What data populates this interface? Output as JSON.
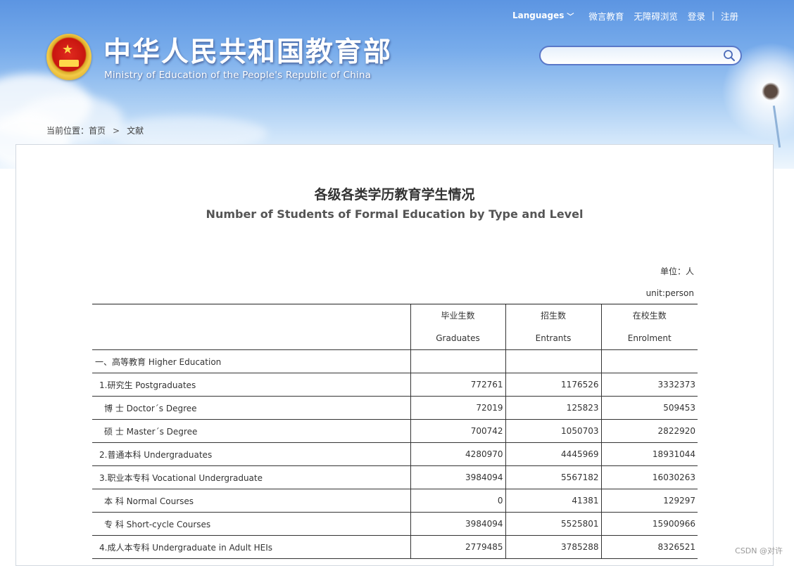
{
  "header": {
    "title": "中华人民共和国教育部",
    "subtitle": "Ministry of Education of the People's Republic of China",
    "emblem_icon": "national-emblem-icon"
  },
  "topnav": {
    "languages": "Languages",
    "wechat": "微言教育",
    "accessibility": "无障碍浏览",
    "login": "登录",
    "separator": "|",
    "register": "注册"
  },
  "search": {
    "placeholder": "",
    "value": ""
  },
  "breadcrumb": {
    "prefix": "当前位置：",
    "home": "首页",
    "separator": ">",
    "current": "文献"
  },
  "page": {
    "title_cn": "各级各类学历教育学生情况",
    "title_en": "Number of Students of Formal Education by Type and Level",
    "unit_cn": "单位：人",
    "unit_en": "unit:person"
  },
  "table": {
    "headers": [
      {
        "cn": "",
        "en": ""
      },
      {
        "cn": "毕业生数",
        "en": "Graduates"
      },
      {
        "cn": "招生数",
        "en": "Entrants"
      },
      {
        "cn": "在校生数",
        "en": "Enrolment"
      }
    ],
    "rows": [
      {
        "label": "一、高等教育 Higher Education",
        "graduates": "",
        "entrants": "",
        "enrolment": ""
      },
      {
        "label": "1.研究生 Postgraduates",
        "graduates": "772761",
        "entrants": "1176526",
        "enrolment": "3332373"
      },
      {
        "label": "博 士 Doctor´s Degree",
        "graduates": "72019",
        "entrants": "125823",
        "enrolment": "509453"
      },
      {
        "label": "硕 士 Master´s Degree",
        "graduates": "700742",
        "entrants": "1050703",
        "enrolment": "2822920"
      },
      {
        "label": "2.普通本科 Undergraduates",
        "graduates": "4280970",
        "entrants": "4445969",
        "enrolment": "18931044"
      },
      {
        "label": "3.职业本专科 Vocational Undergraduate",
        "graduates": "3984094",
        "entrants": "5567182",
        "enrolment": "16030263"
      },
      {
        "label": "本 科 Normal Courses",
        "graduates": "0",
        "entrants": "41381",
        "enrolment": "129297"
      },
      {
        "label": "专 科 Short-cycle Courses",
        "graduates": "3984094",
        "entrants": "5525801",
        "enrolment": "15900966"
      },
      {
        "label": "4.成人本专科 Undergraduate in Adult HEIs",
        "graduates": "2779485",
        "entrants": "3785288",
        "enrolment": "8326521"
      }
    ]
  },
  "watermark": "CSDN @对许"
}
